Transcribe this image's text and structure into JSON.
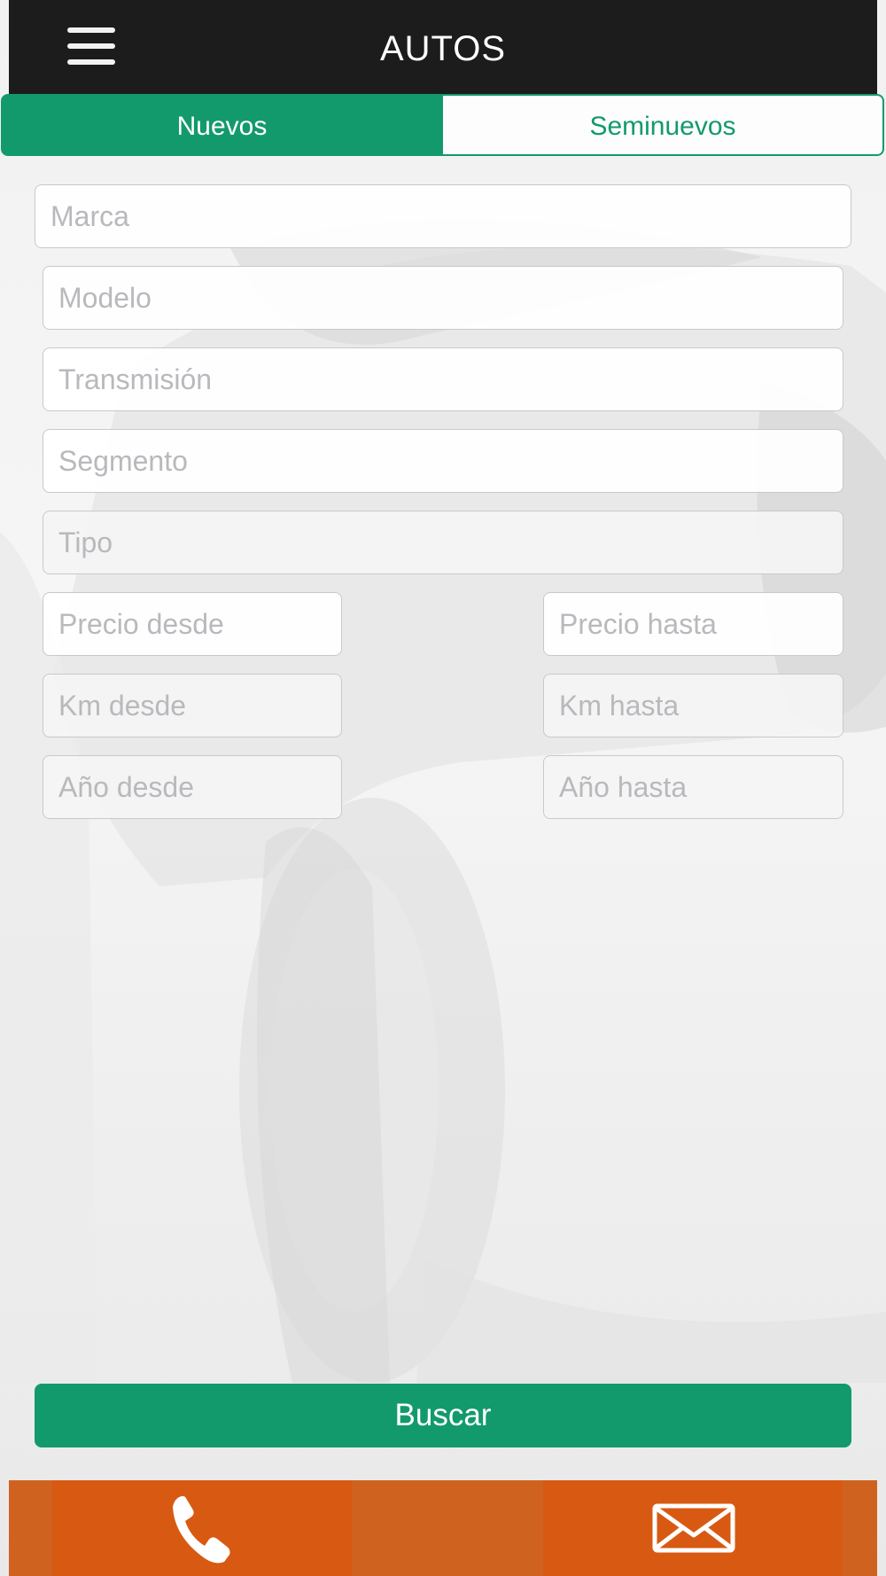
{
  "header": {
    "title": "AUTOS",
    "menu_icon": "hamburger-menu-icon"
  },
  "tabs": [
    {
      "label": "Nuevos",
      "active": true
    },
    {
      "label": "Seminuevos",
      "active": false
    }
  ],
  "form": {
    "marca": {
      "placeholder": "Marca",
      "value": ""
    },
    "modelo": {
      "placeholder": "Modelo",
      "value": ""
    },
    "transmision": {
      "placeholder": "Transmisión",
      "value": ""
    },
    "segmento": {
      "placeholder": "Segmento",
      "value": ""
    },
    "tipo": {
      "placeholder": "Tipo",
      "value": ""
    },
    "precio_desde": {
      "placeholder": "Precio desde",
      "value": ""
    },
    "precio_hasta": {
      "placeholder": "Precio hasta",
      "value": ""
    },
    "km_desde": {
      "placeholder": "Km desde",
      "value": ""
    },
    "km_hasta": {
      "placeholder": "Km hasta",
      "value": ""
    },
    "anio_desde": {
      "placeholder": "Año desde",
      "value": ""
    },
    "anio_hasta": {
      "placeholder": "Año hasta",
      "value": ""
    }
  },
  "search_button": {
    "label": "Buscar"
  },
  "bottom_bar": {
    "call_icon": "phone-icon",
    "mail_icon": "envelope-icon"
  },
  "colors": {
    "header_bg": "#1d1c1d",
    "accent_green": "#139a6c",
    "bottom_orange": "#d85a12",
    "placeholder_gray": "#b9b9bd"
  }
}
